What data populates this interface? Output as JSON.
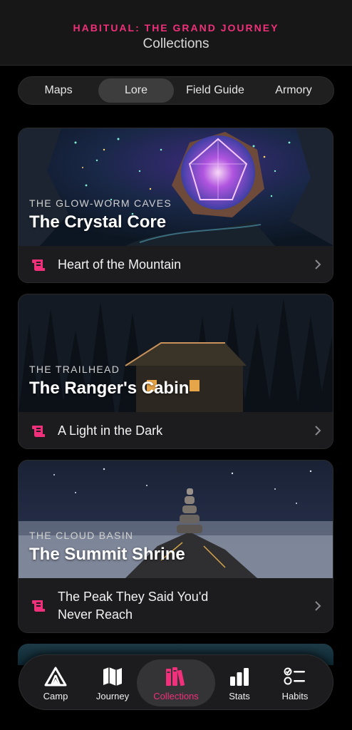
{
  "header": {
    "app_name": "HABITUAL: THE GRAND JOURNEY",
    "title": "Collections"
  },
  "segments": [
    {
      "label": "Maps",
      "active": false
    },
    {
      "label": "Lore",
      "active": true
    },
    {
      "label": "Field Guide",
      "active": false
    },
    {
      "label": "Armory",
      "active": false
    }
  ],
  "cards": [
    {
      "location": "THE GLOW-WORM CAVES",
      "title": "The Crystal Core",
      "entry": "Heart of the Mountain",
      "entry_icon": "scroll-icon"
    },
    {
      "location": "THE TRAILHEAD",
      "title": "The Ranger's Cabin",
      "entry": "A Light in the Dark",
      "entry_icon": "scroll-icon"
    },
    {
      "location": "THE CLOUD BASIN",
      "title": "The Summit Shrine",
      "entry_line1": "The Peak They Said You'd",
      "entry_line2": "Never Reach",
      "entry_icon": "scroll-icon"
    }
  ],
  "tabs": [
    {
      "label": "Camp",
      "icon": "tent-icon"
    },
    {
      "label": "Journey",
      "icon": "map-icon"
    },
    {
      "label": "Collections",
      "icon": "books-icon",
      "active": true
    },
    {
      "label": "Stats",
      "icon": "bar-chart-icon"
    },
    {
      "label": "Habits",
      "icon": "checklist-icon"
    }
  ],
  "colors": {
    "accent": "#f0307a",
    "background": "#000000",
    "card": "#1c1c1e"
  }
}
